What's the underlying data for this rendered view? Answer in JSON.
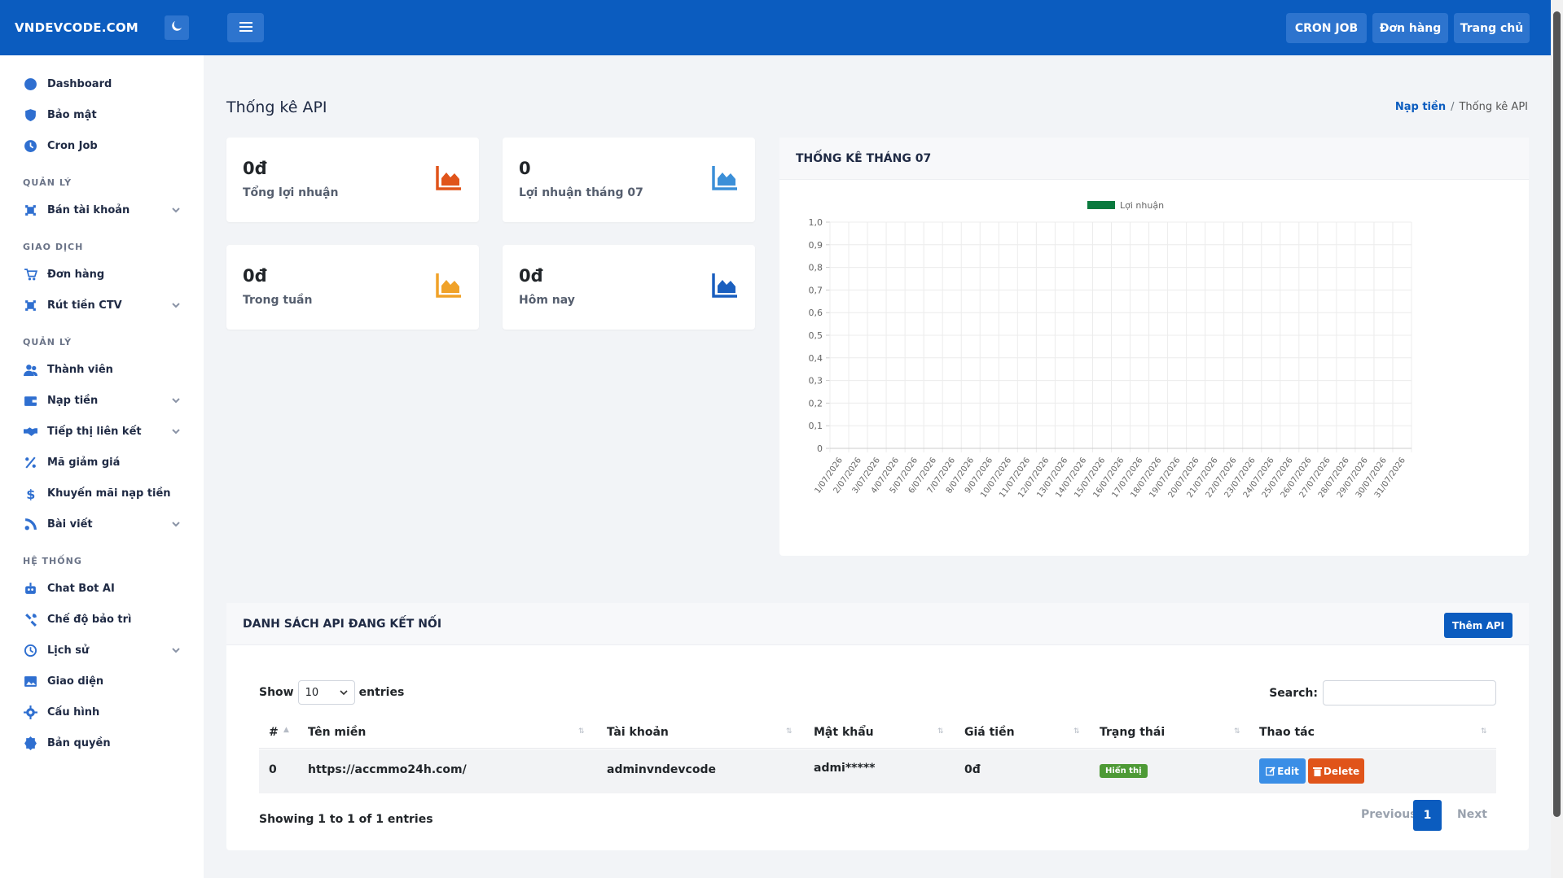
{
  "brand": {
    "name": "VNDEVCODE.COM",
    "theme_icon": "moon-icon"
  },
  "topbar": {
    "menu_icon": "hamburger-icon",
    "buttons": [
      "CRON JOB",
      "Đơn hàng",
      "Trang chủ"
    ]
  },
  "sidebar": {
    "items_top": [
      {
        "label": "Dashboard",
        "icon": "dashboard-icon"
      },
      {
        "label": "Bảo mật",
        "icon": "shield-icon"
      },
      {
        "label": "Cron Job",
        "icon": "clock-icon"
      }
    ],
    "sections": [
      {
        "title": "QUẢN LÝ",
        "items": [
          {
            "label": "Bán tài khoản",
            "icon": "box-icon",
            "has_children": true
          }
        ]
      },
      {
        "title": "GIAO DỊCH",
        "items": [
          {
            "label": "Đơn hàng",
            "icon": "cart-icon",
            "has_children": false
          },
          {
            "label": "Rút tiền CTV",
            "icon": "box-icon",
            "has_children": true
          }
        ]
      },
      {
        "title": "QUẢN LÝ",
        "items": [
          {
            "label": "Thành viên",
            "icon": "users-icon",
            "has_children": false
          },
          {
            "label": "Nạp tiền",
            "icon": "wallet-icon",
            "has_children": true
          },
          {
            "label": "Tiếp thị liên kết",
            "icon": "handshake-icon",
            "has_children": true
          },
          {
            "label": "Mã giảm giá",
            "icon": "percent-icon",
            "has_children": false
          },
          {
            "label": "Khuyến mãi nạp tiền",
            "icon": "dollar-icon",
            "has_children": false
          },
          {
            "label": "Bài viết",
            "icon": "blog-icon",
            "has_children": true
          }
        ]
      },
      {
        "title": "HỆ THỐNG",
        "items": [
          {
            "label": "Chat Bot AI",
            "icon": "robot-icon",
            "has_children": false
          },
          {
            "label": "Chế độ bảo trì",
            "icon": "tools-icon",
            "has_children": false
          },
          {
            "label": "Lịch sử",
            "icon": "history-icon",
            "has_children": true
          },
          {
            "label": "Giao diện",
            "icon": "image-icon",
            "has_children": false
          },
          {
            "label": "Cấu hình",
            "icon": "gear-icon",
            "has_children": false
          },
          {
            "label": "Bản quyền",
            "icon": "badge-icon",
            "has_children": false
          }
        ]
      }
    ]
  },
  "page": {
    "title": "Thống kê API",
    "breadcrumb": {
      "link": "Nạp tiền",
      "sep": "/",
      "current": "Thống kê API"
    }
  },
  "stats": [
    {
      "value": "0đ",
      "label": "Tổng lợi nhuận",
      "color": "#e0541a"
    },
    {
      "value": "0",
      "label": "Lợi nhuận tháng 07",
      "color": "#3b8fd8"
    },
    {
      "value": "0đ",
      "label": "Trong tuần",
      "color": "#f0a229"
    },
    {
      "value": "0đ",
      "label": "Hôm nay",
      "color": "#1a5fbf"
    }
  ],
  "chart_panel": {
    "title": "THỐNG KÊ THÁNG 07"
  },
  "chart_data": {
    "type": "bar",
    "title": "",
    "legend": "top-center",
    "series": [
      {
        "name": "Lợi nhuận",
        "color": "#0a7a3e",
        "values": [
          0,
          0,
          0,
          0,
          0,
          0,
          0,
          0,
          0,
          0,
          0,
          0,
          0,
          0,
          0,
          0,
          0,
          0,
          0,
          0,
          0,
          0,
          0,
          0,
          0,
          0,
          0,
          0,
          0,
          0,
          0
        ]
      }
    ],
    "categories": [
      "1/07/2026",
      "2/07/2026",
      "3/07/2026",
      "4/07/2026",
      "5/07/2026",
      "6/07/2026",
      "7/07/2026",
      "8/07/2026",
      "9/07/2026",
      "10/07/2026",
      "11/07/2026",
      "12/07/2026",
      "13/07/2026",
      "14/07/2026",
      "15/07/2026",
      "16/07/2026",
      "17/07/2026",
      "18/07/2026",
      "19/07/2026",
      "20/07/2026",
      "21/07/2026",
      "22/07/2026",
      "23/07/2026",
      "24/07/2026",
      "25/07/2026",
      "26/07/2026",
      "27/07/2026",
      "28/07/2026",
      "29/07/2026",
      "30/07/2026",
      "31/07/2026"
    ],
    "ylim": [
      0,
      1
    ],
    "yticks": [
      "1,0",
      "0,9",
      "0,8",
      "0,7",
      "0,6",
      "0,5",
      "0,4",
      "0,3",
      "0,2",
      "0,1",
      "0"
    ],
    "grid": true,
    "xlabel": "",
    "ylabel": ""
  },
  "api_list": {
    "title": "DANH SÁCH API ĐANG KẾT NỐI",
    "add_button": "Thêm API",
    "show_label": "Show",
    "show_value": "10",
    "entries_label": "entries",
    "search_label": "Search:",
    "search_value": "",
    "columns": [
      "#",
      "Tên miền",
      "Tài khoản",
      "Mật khẩu",
      "Giá tiền",
      "Trạng thái",
      "Thao tác"
    ],
    "rows": [
      {
        "id": "0",
        "domain": "https://accmmo24h.com/",
        "account": "adminvndevcode",
        "password": "admi*****",
        "price": "0đ",
        "status": "Hiển thị",
        "edit": "Edit",
        "delete": "Delete"
      }
    ],
    "info": "Showing 1 to 1 of 1 entries",
    "pagination": {
      "prev": "Previous",
      "current": "1",
      "next": "Next"
    }
  }
}
